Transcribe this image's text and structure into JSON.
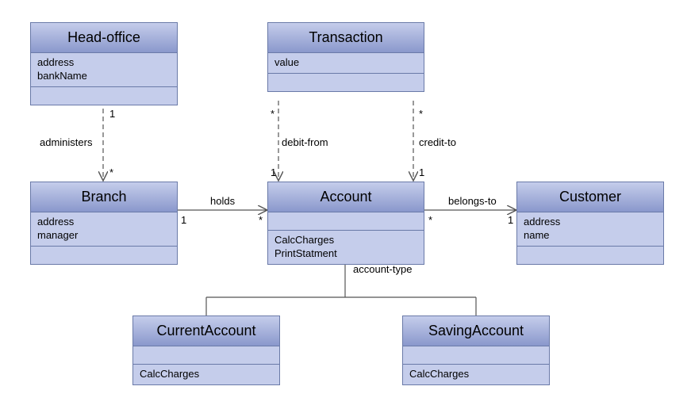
{
  "classes": {
    "headOffice": {
      "name": "Head-office",
      "attrs": [
        "address",
        "bankName"
      ]
    },
    "transaction": {
      "name": "Transaction",
      "attrs": [
        "value"
      ]
    },
    "branch": {
      "name": "Branch",
      "attrs": [
        "address",
        "manager"
      ]
    },
    "account": {
      "name": "Account",
      "ops": [
        "CalcCharges",
        "PrintStatment"
      ]
    },
    "customer": {
      "name": "Customer",
      "attrs": [
        "address",
        "name"
      ]
    },
    "currentAccount": {
      "name": "CurrentAccount",
      "ops": [
        "CalcCharges"
      ]
    },
    "savingAccount": {
      "name": "SavingAccount",
      "ops": [
        "CalcCharges"
      ]
    }
  },
  "relations": {
    "administers": {
      "label": "administers",
      "m1": "1",
      "m2": "*"
    },
    "debitFrom": {
      "label": "debit-from",
      "m1": "*",
      "m2": "1"
    },
    "creditTo": {
      "label": "credit-to",
      "m1": "*",
      "m2": "1"
    },
    "holds": {
      "label": "holds",
      "m1": "1",
      "m2": "*"
    },
    "belongsTo": {
      "label": "belongs-to",
      "m1": "*",
      "m2": "1"
    },
    "accountType": {
      "label": "account-type"
    }
  }
}
